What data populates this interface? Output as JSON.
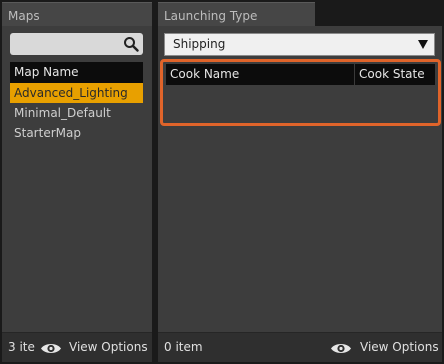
{
  "left_panel": {
    "tab_title": "Maps",
    "search": {
      "value": "",
      "icon": "search-icon"
    },
    "list_header": "Map Name",
    "items": [
      {
        "label": "Advanced_Lighting",
        "selected": true
      },
      {
        "label": "Minimal_Default",
        "selected": false
      },
      {
        "label": "StarterMap",
        "selected": false
      }
    ],
    "footer": {
      "count": "3 ite",
      "view_options": "View Options"
    }
  },
  "right_panel": {
    "tab_title": "Launching Type",
    "dropdown": {
      "selected": "Shipping"
    },
    "table": {
      "columns": [
        "Cook Name",
        "Cook State"
      ],
      "rows": []
    },
    "footer": {
      "count": "0 item",
      "view_options": "View Options"
    }
  },
  "colors": {
    "selection": "#e8a000",
    "highlight_outline": "#e0642a",
    "panel_bg": "#3d3d3d"
  }
}
